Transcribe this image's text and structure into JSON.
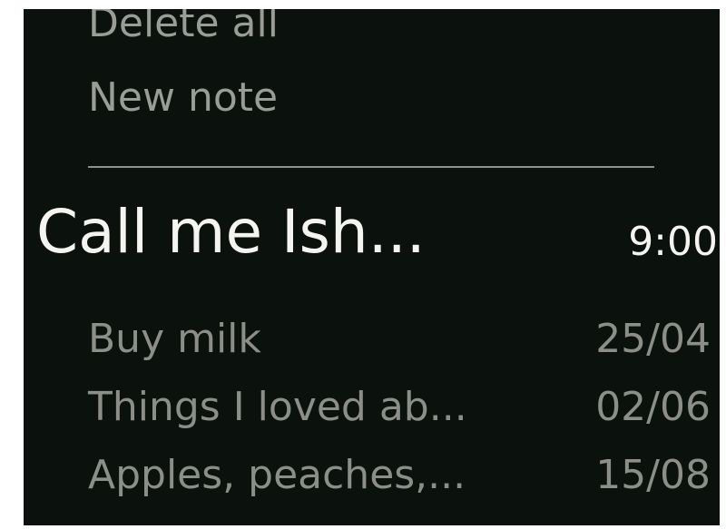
{
  "menu": {
    "delete_all": "Delete all",
    "new_note": "New note"
  },
  "notes": [
    {
      "title": "Call me Ish...",
      "date": "9:00",
      "selected": true
    },
    {
      "title": "Buy milk",
      "date": "25/04",
      "selected": false
    },
    {
      "title": "Things I loved ab...",
      "date": "02/06",
      "selected": false
    },
    {
      "title": "Apples, peaches,...",
      "date": "15/08",
      "selected": false
    }
  ],
  "colors": {
    "background": "#0b110d",
    "selected_text": "#f4f4f0",
    "dim_text": "#8c8e88",
    "divider": "#8f918b"
  }
}
